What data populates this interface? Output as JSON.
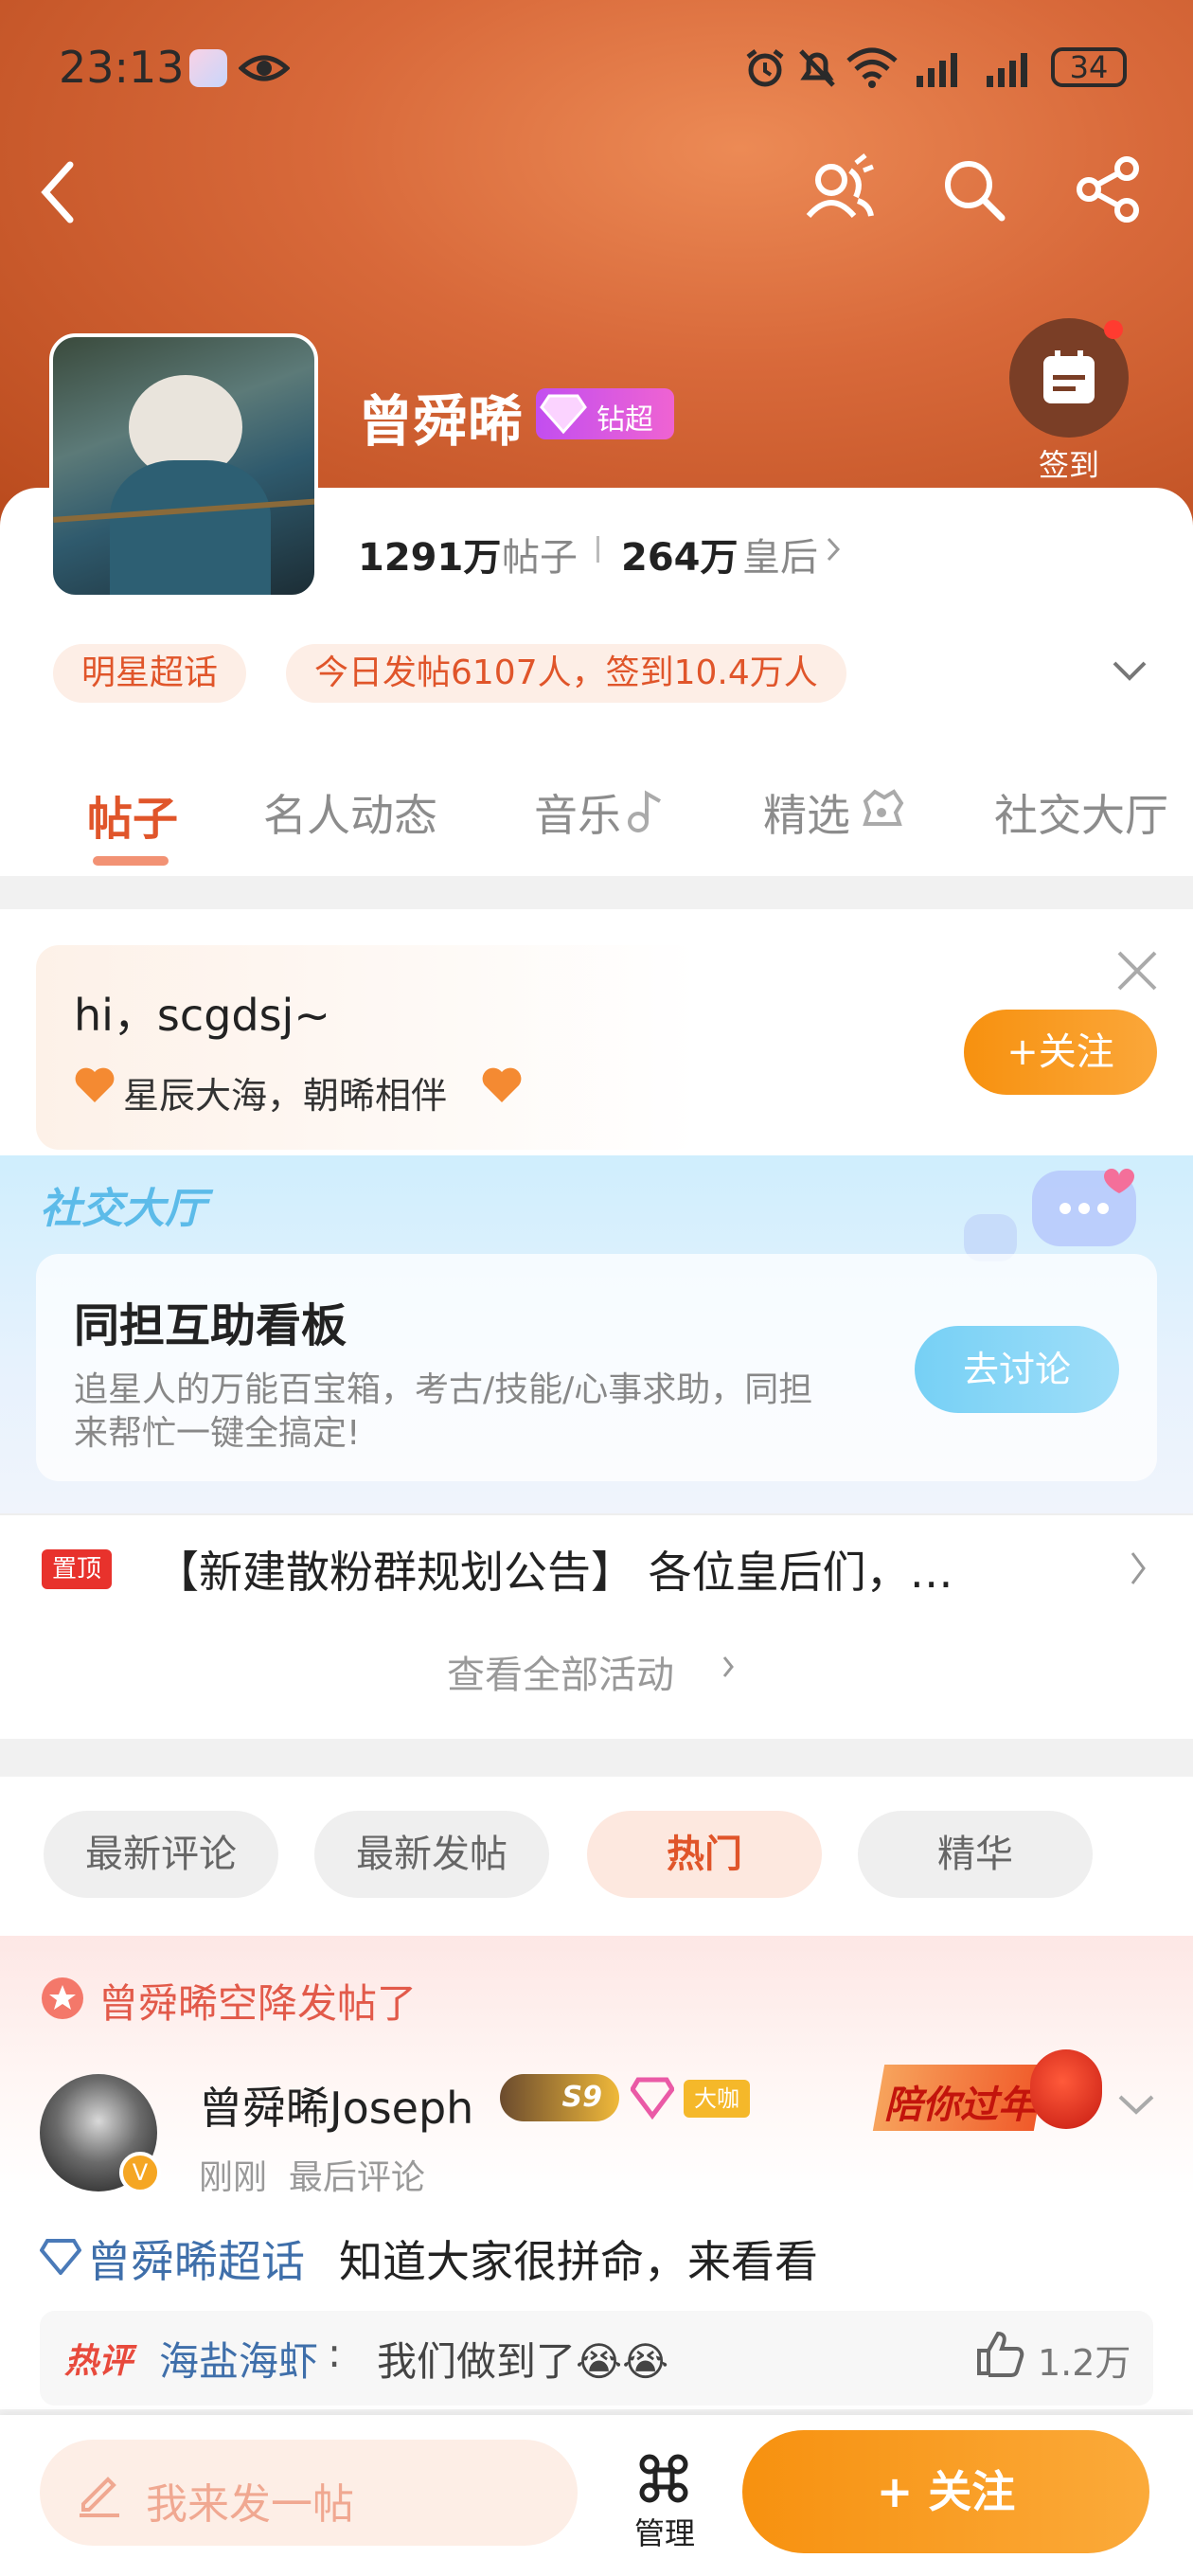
{
  "status_bar": {
    "time": "23:13",
    "battery": "34"
  },
  "profile": {
    "name": "曾舜晞",
    "badge": "钻超",
    "checkin_label": "签到",
    "posts_count": "1291万",
    "posts_label": "帖子",
    "members_count": "264万",
    "members_label": "皇后"
  },
  "tags": {
    "category": "明星超话",
    "today_stats": "今日发帖6107人，签到10.4万人"
  },
  "tabs": [
    "帖子",
    "名人动态",
    "音乐",
    "精选",
    "社交大厅"
  ],
  "greeting": {
    "title": "hi，scgdsj~",
    "subtitle": "星辰大海，朝晞相伴",
    "follow_label": "+关注"
  },
  "social_hall": {
    "banner_title": "社交大厅",
    "card_title": "同担互助看板",
    "card_desc_line1": "追星人的万能百宝箱，考古/技能/心事求助，同担",
    "card_desc_line2": "来帮忙一键全搞定!",
    "discuss_button": "去讨论"
  },
  "pinned": {
    "tag": "置顶",
    "text": "【新建散粉群规划公告】 各位皇后们，…",
    "view_all": "查看全部活动"
  },
  "filters": [
    {
      "label": "最新评论",
      "active": false
    },
    {
      "label": "最新发帖",
      "active": false
    },
    {
      "label": "热门",
      "active": true
    },
    {
      "label": "精华",
      "active": false
    }
  ],
  "post": {
    "banner": "曾舜晞空降发帖了",
    "author": "曾舜晞Joseph",
    "level_badge": "S9",
    "role_badge": "大咖",
    "promo": "陪你过年",
    "time_meta": "刚刚  最后评论",
    "topic": "曾舜晞超话",
    "content": "知道大家很拼命，来看看",
    "hot_comment": {
      "tag": "热评",
      "user": "海盐海虾",
      "text": "我们做到了😭😭",
      "likes": "1.2万"
    }
  },
  "bottom_bar": {
    "compose_placeholder": "我来发一帖",
    "manage_label": "管理",
    "follow_label": "+ 关注"
  },
  "colors": {
    "accent": "#f28a1b",
    "brand_orange": "#e0552a",
    "hero": "#d8693a"
  }
}
